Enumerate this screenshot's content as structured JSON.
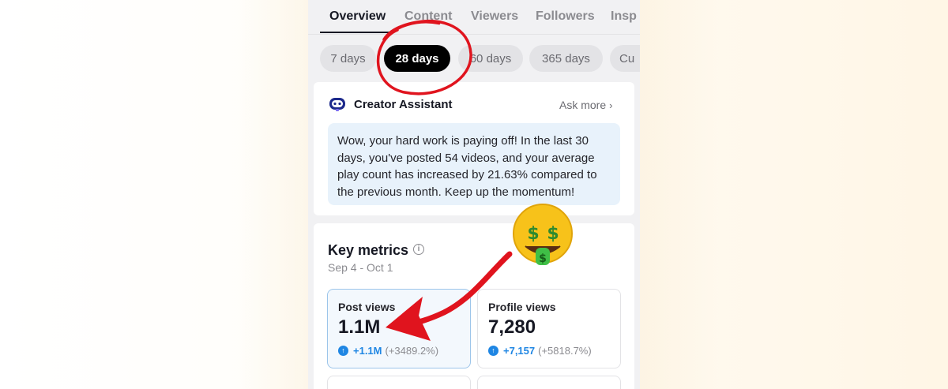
{
  "tabs": [
    {
      "label": "Overview",
      "active": true
    },
    {
      "label": "Content",
      "active": false
    },
    {
      "label": "Viewers",
      "active": false
    },
    {
      "label": "Followers",
      "active": false
    },
    {
      "label": "Insp",
      "active": false
    }
  ],
  "date_filters": [
    {
      "label": "7 days",
      "active": false
    },
    {
      "label": "28 days",
      "active": true
    },
    {
      "label": "60 days",
      "active": false
    },
    {
      "label": "365 days",
      "active": false
    },
    {
      "label": "Cu",
      "active": false
    }
  ],
  "assistant": {
    "icon": "creator-assistant-icon",
    "title": "Creator Assistant",
    "ask_more": "Ask more",
    "chevron": "›",
    "message": "Wow, your hard work is paying off! In the last 30 days, you've posted 54 videos, and your average play count has increased by 21.63% compared to the previous month. Keep up the momentum!"
  },
  "key_metrics": {
    "title": "Key metrics",
    "info_icon": "i",
    "date_range": "Sep 4 - Oct 1",
    "cards": [
      {
        "label": "Post views",
        "value": "1.1M",
        "change": "+1.1M",
        "percent": "(+3489.2%)",
        "selected": true
      },
      {
        "label": "Profile views",
        "value": "7,280",
        "change": "+7,157",
        "percent": "(+5818.7%)",
        "selected": false
      }
    ]
  },
  "colors": {
    "accent_blue": "#1f86e3",
    "annotation_red": "#e0141e",
    "active_pill": "#000000",
    "bubble_bg": "#e8f2fb"
  },
  "decorations": {
    "emoji": "money-mouth-face",
    "circle_annotation": "red-hand-drawn-circle",
    "arrow_annotation": "red-hand-drawn-arrow"
  }
}
